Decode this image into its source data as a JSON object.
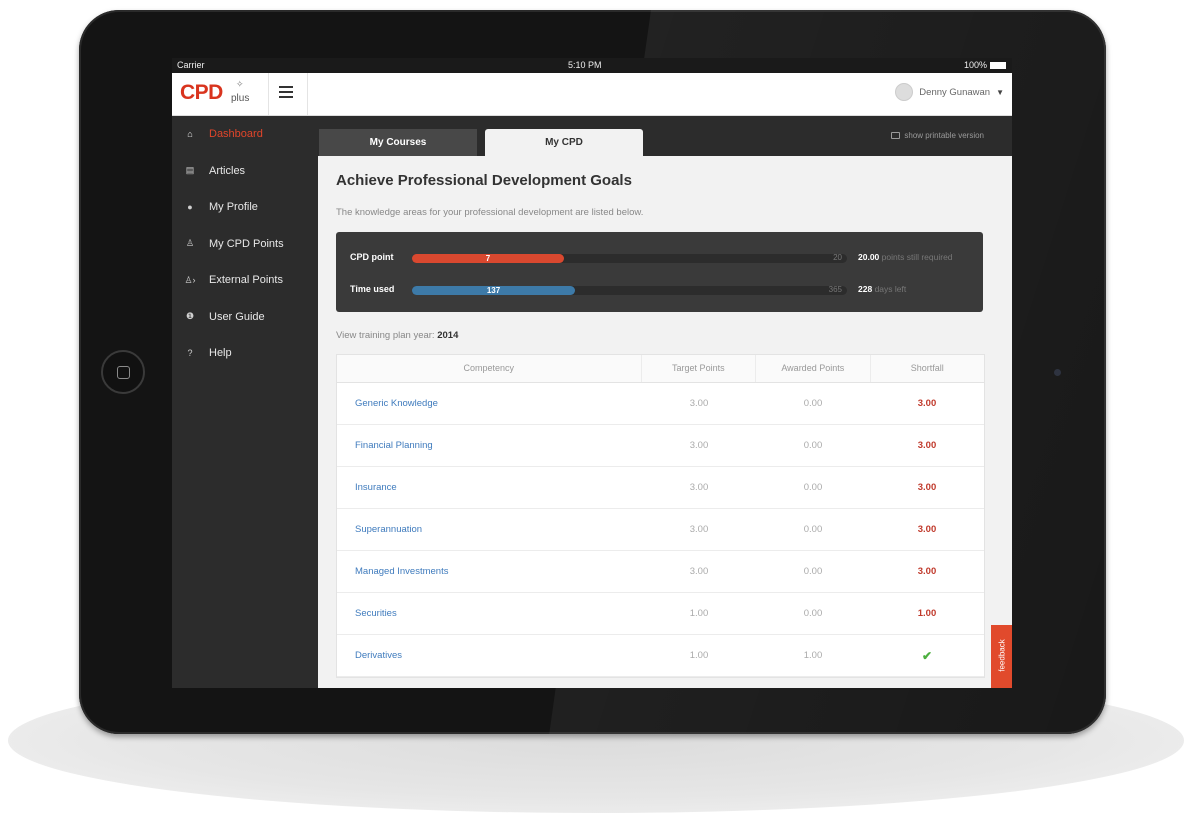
{
  "device": {
    "frame_color": "#141414"
  },
  "status_bar": {
    "carrier": "Carrier",
    "time": "5:10 PM",
    "battery": "100%"
  },
  "app_bar": {
    "logo_main": "CPD",
    "logo_sub": "plus",
    "user_name": "Denny Gunawan"
  },
  "sidebar": {
    "items": [
      {
        "label": "Dashboard",
        "icon": "home-icon",
        "active": true
      },
      {
        "label": "Articles",
        "icon": "document-icon",
        "active": false
      },
      {
        "label": "My Profile",
        "icon": "user-icon",
        "active": false
      },
      {
        "label": "My CPD Points",
        "icon": "user-points-icon",
        "active": false
      },
      {
        "label": "External Points",
        "icon": "external-points-icon",
        "active": false
      },
      {
        "label": "User Guide",
        "icon": "info-icon",
        "active": false
      },
      {
        "label": "Help",
        "icon": "help-icon",
        "active": false
      }
    ]
  },
  "tabs": {
    "my_courses": "My Courses",
    "my_cpd": "My CPD",
    "active": "My CPD"
  },
  "printable_link": "show printable version",
  "page": {
    "title": "Achieve Professional Development Goals",
    "description": "The knowledge areas for your professional development are listed below."
  },
  "progress": {
    "cpd_point": {
      "label": "CPD point",
      "value": 7,
      "value_text": "7",
      "max": 20,
      "max_text": "20",
      "note_value": "20.00",
      "note_text": "points still required",
      "color": "#d9482f"
    },
    "time_used": {
      "label": "Time used",
      "value": 137,
      "value_text": "137",
      "max": 365,
      "max_text": "365",
      "note_value": "228",
      "note_text": "days left",
      "color": "#3d7aa8"
    }
  },
  "training_plan": {
    "label": "View training plan year:",
    "year": "2014"
  },
  "table": {
    "headers": [
      "Competency",
      "Target Points",
      "Awarded Points",
      "Shortfall"
    ],
    "rows": [
      {
        "competency": "Generic Knowledge",
        "target": "3.00",
        "awarded": "0.00",
        "shortfall": "3.00"
      },
      {
        "competency": "Financial Planning",
        "target": "3.00",
        "awarded": "0.00",
        "shortfall": "3.00"
      },
      {
        "competency": "Insurance",
        "target": "3.00",
        "awarded": "0.00",
        "shortfall": "3.00"
      },
      {
        "competency": "Superannuation",
        "target": "3.00",
        "awarded": "0.00",
        "shortfall": "3.00"
      },
      {
        "competency": "Managed Investments",
        "target": "3.00",
        "awarded": "0.00",
        "shortfall": "3.00"
      },
      {
        "competency": "Securities",
        "target": "1.00",
        "awarded": "0.00",
        "shortfall": "1.00"
      },
      {
        "competency": "Derivatives",
        "target": "1.00",
        "awarded": "1.00",
        "shortfall": "✔"
      }
    ]
  },
  "feedback_tab": "feedback",
  "colors": {
    "accent": "#e0452a",
    "sidebar_bg": "#2c2c2c",
    "link": "#3f7bbd",
    "shortfall": "#c0392b",
    "check": "#4caf3f"
  }
}
